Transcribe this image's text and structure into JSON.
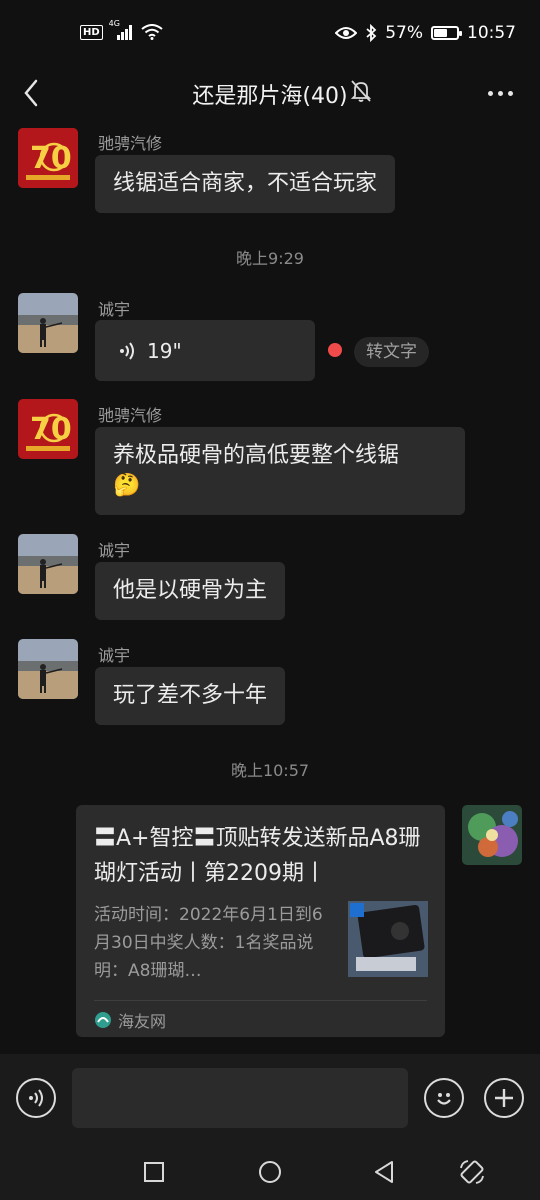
{
  "status_bar": {
    "hd": "HD",
    "network": "4G",
    "battery_percent_text": "57%",
    "battery_level": 0.57,
    "time": "10:57"
  },
  "header": {
    "title": "还是那片海(40)",
    "back_icon": "back-chevron-icon",
    "mute_icon": "bell-off-icon",
    "more_icon": "more-dots-icon"
  },
  "messages": [
    {
      "sender": "驰骋汽修",
      "text": "线锯适合商家，不适合玩家"
    },
    {
      "timestamp": "晚上9:29"
    },
    {
      "sender": "诚宇",
      "voice_duration": "19\"",
      "to_text_label": "转文字"
    },
    {
      "sender": "驰骋汽修",
      "text": "养极品硬骨的高低要整个线锯",
      "emoji": "🤔"
    },
    {
      "sender": "诚宇",
      "text": "他是以硬骨为主"
    },
    {
      "sender": "诚宇",
      "text": "玩了差不多十年"
    },
    {
      "timestamp": "晚上10:57"
    },
    {
      "link_card": {
        "title": "〓A+智控〓顶贴转发送新品A8珊 瑚灯活动丨第2209期丨",
        "description": "活动时间：2022年6月1日到6月30日中奖人数：1名奖品说明：A8珊瑚…",
        "source": "海友网"
      }
    }
  ],
  "input_bar": {
    "voice_icon": "voice-mode-icon",
    "emoji_icon": "emoji-icon",
    "plus_icon": "plus-icon",
    "value": ""
  },
  "colors": {
    "background": "#111111",
    "bubble": "#2c2c2c",
    "red_dot": "#f04a4a"
  }
}
